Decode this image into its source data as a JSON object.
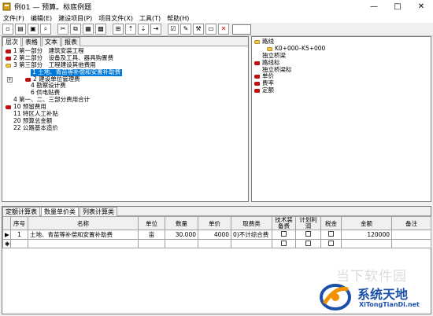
{
  "window": {
    "title": "例01 — 预算。标底例题",
    "minimize": "—",
    "maximize": "□",
    "close": "✕"
  },
  "menu": [
    "文件(F)",
    "编辑(E)",
    "建设项目(P)",
    "项目文件(X)",
    "工具(T)",
    "帮助(H)"
  ],
  "top_tabs": [
    "层次",
    "表格",
    "文本",
    "报表"
  ],
  "tree": [
    {
      "label": "1 第一部分　建筑安装工程",
      "icon": "red"
    },
    {
      "label": "2 第二部分　设备及工具、器具购置费",
      "icon": "red"
    },
    {
      "label": "3 第三部分　工程建设其他费用",
      "icon": "yellow"
    },
    {
      "label": "1 土地、青苗等补偿和安置补助费",
      "icon": "none",
      "selected": true
    },
    {
      "label": "2 建设单位管理费",
      "icon": "red",
      "plus": true
    },
    {
      "label": "4 勘察设计费",
      "icon": "none"
    },
    {
      "label": "6 供电贴费",
      "icon": "none"
    },
    {
      "label": "4 第一、二、三部分费用合计",
      "icon": "none"
    },
    {
      "label": "10 预留费用",
      "icon": "red"
    },
    {
      "label": "11 特区人工补贴",
      "icon": "none"
    },
    {
      "label": "20 预算总金额",
      "icon": "none"
    },
    {
      "label": "22 公路基本造价",
      "icon": "none"
    }
  ],
  "right_tree": [
    {
      "label": "路线",
      "icon": "yellow"
    },
    {
      "label": "K0+000–K5+000",
      "icon": "none"
    },
    {
      "label": "独立桥梁",
      "icon": "none"
    },
    {
      "label": "路线标",
      "icon": "red"
    },
    {
      "label": "独立桥梁标",
      "icon": "none"
    },
    {
      "label": "单价",
      "icon": "red"
    },
    {
      "label": "费率",
      "icon": "red"
    },
    {
      "label": "定额",
      "icon": "red"
    }
  ],
  "bottom_tabs": [
    "定额计算表",
    "数量单价类",
    "列表计算类"
  ],
  "grid": {
    "headers": [
      "序号",
      "名称",
      "单位",
      "数量",
      "单价",
      "取费类",
      "技术装备费",
      "计划利润",
      "税金",
      "金额",
      "备注"
    ],
    "rows": [
      {
        "seq": "1",
        "name": "土地、青苗等补偿和安置补助费",
        "unit": "亩",
        "qty": "30.000",
        "price": "4000",
        "fee": "0)不计综合费",
        "amount": "120000"
      }
    ]
  },
  "watermark": {
    "ghost": "当下软件园",
    "brand": "系统天地",
    "url": "XiTongTianDi.net"
  }
}
